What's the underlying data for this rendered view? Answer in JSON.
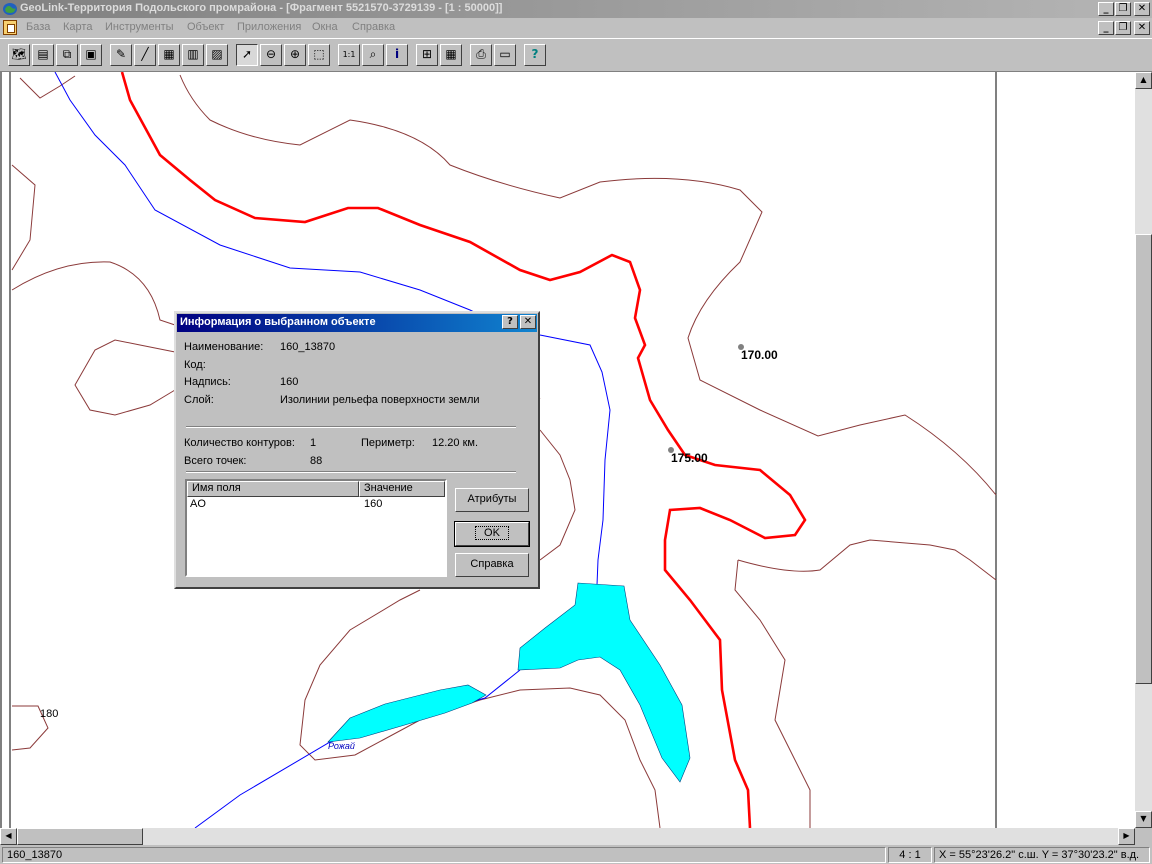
{
  "window": {
    "title": "GeoLink-Территория Подольского промрайона - [Фрагмент 5521570-3729139 - [1 : 50000]]",
    "minimize_glyph": "_",
    "restore_glyph": "❐",
    "close_glyph": "✕"
  },
  "menu": {
    "items": [
      "База",
      "Карта",
      "Инструменты",
      "Объект",
      "Приложения",
      "Окна",
      "Справка"
    ]
  },
  "toolbar": {
    "buttons": [
      {
        "icon": "open-map-icon",
        "glyph": "🗺"
      },
      {
        "icon": "layers-icon",
        "glyph": "▤"
      },
      {
        "icon": "copy-map-icon",
        "glyph": "⧉"
      },
      {
        "icon": "fragment-icon",
        "glyph": "▣"
      },
      {
        "icon": "edit-object-icon",
        "glyph": "✎"
      },
      {
        "icon": "draw-line-icon",
        "glyph": "╱"
      },
      {
        "icon": "save-icon",
        "glyph": "▦"
      },
      {
        "icon": "edit-attributes-icon",
        "glyph": "▥"
      },
      {
        "icon": "chart-edit-icon",
        "glyph": "▨"
      },
      {
        "icon": "pointer-icon",
        "glyph": "➚"
      },
      {
        "icon": "zoom-out-icon",
        "glyph": "⊖"
      },
      {
        "icon": "zoom-in-icon",
        "glyph": "⊕"
      },
      {
        "icon": "zoom-area-icon",
        "glyph": "⬚"
      },
      {
        "icon": "scale-icon",
        "glyph": "1:1"
      },
      {
        "icon": "find-icon",
        "glyph": "⌕"
      },
      {
        "icon": "info-icon",
        "glyph": "i"
      },
      {
        "icon": "new-window-icon",
        "glyph": "⊞"
      },
      {
        "icon": "table-icon",
        "glyph": "▦"
      },
      {
        "icon": "print-icon",
        "glyph": "⎙"
      },
      {
        "icon": "export-icon",
        "glyph": "▭"
      },
      {
        "icon": "help-icon",
        "glyph": "?"
      }
    ]
  },
  "map": {
    "labels": {
      "contour_170": "170.00",
      "contour_175": "175.00",
      "contour_180": "180",
      "river_name": "Рожай"
    },
    "colors": {
      "selected_contour": "#ff0000",
      "contour": "#8b3a3a",
      "river": "#0000ff",
      "water": "#00ffff"
    }
  },
  "dialog": {
    "title": "Информация о выбранном объекте",
    "help_glyph": "?",
    "close_glyph": "✕",
    "name_label": "Наименование:",
    "name_value": "160_13870",
    "code_label": "Код:",
    "code_value": "",
    "caption_label": "Надпись:",
    "caption_value": "160",
    "layer_label": "Слой:",
    "layer_value": "Изолинии рельефа поверхности земли",
    "contours_label": "Количество контуров:",
    "contours_value": "1",
    "perimeter_label": "Периметр:",
    "perimeter_value": "12.20 км.",
    "points_label": "Всего точек:",
    "points_value": "88",
    "table": {
      "columns": [
        "Имя поля",
        "Значение"
      ],
      "rows": [
        {
          "field": "AO",
          "value": "160"
        }
      ]
    },
    "buttons": {
      "attributes": "Атрибуты",
      "ok": "OK",
      "help": "Справка"
    }
  },
  "status": {
    "object": "160_13870",
    "scale": "4 : 1",
    "coords": "X = 55°23'26.2\" с.ш.  Y = 37°30'23.2\" в.д."
  }
}
